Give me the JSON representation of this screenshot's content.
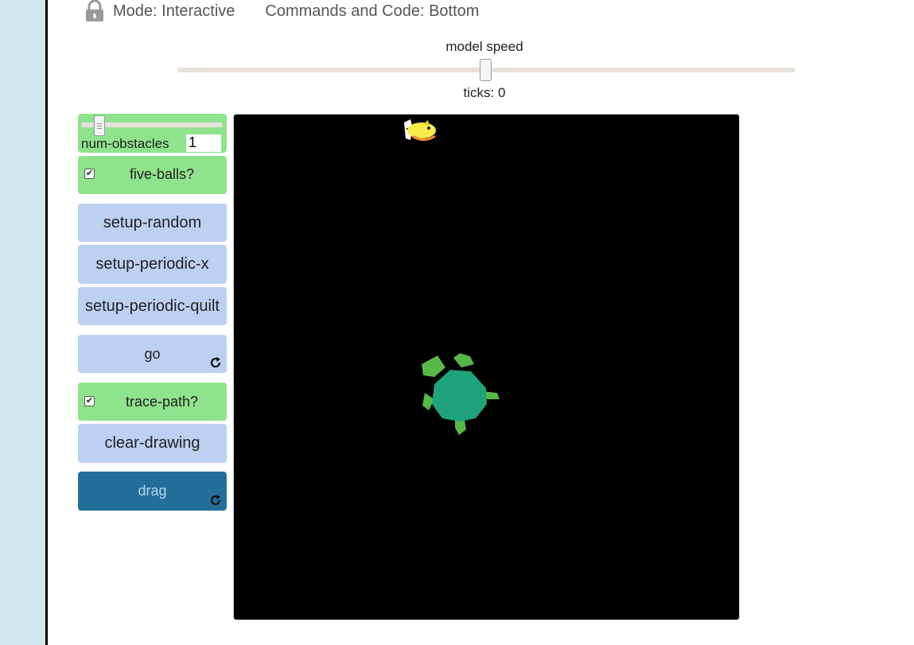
{
  "topbar": {
    "mode_label": "Mode: Interactive",
    "commands_label": "Commands and Code: Bottom"
  },
  "speed": {
    "label": "model speed",
    "ticks_text": "ticks: 0"
  },
  "widgets": {
    "num_obstacles": {
      "label": "num-obstacles",
      "value": "1"
    },
    "five_balls": {
      "label": "five-balls?",
      "checked": true,
      "check_glyph": "✔"
    },
    "setup_random": "setup-random",
    "setup_periodic_x": "setup-periodic-x",
    "setup_periodic_quilt": "setup-periodic-quilt",
    "go": "go",
    "trace_path": {
      "label": "trace-path?",
      "checked": true,
      "check_glyph": "✔"
    },
    "clear_drawing": "clear-drawing",
    "drag": "drag"
  },
  "colors": {
    "sidebar_strip": "#cfe6ec",
    "green_widget": "#8fe38c",
    "blue_widget": "#bcd0f2",
    "active_widget": "#226f99",
    "view_background": "#000000",
    "turtle": "#1fa37a",
    "turtle_limbs": "#58b847"
  },
  "icons": {
    "lock": "lock-icon",
    "forever": "forever-icon",
    "fish": "fish-icon",
    "turtle": "turtle-icon"
  }
}
